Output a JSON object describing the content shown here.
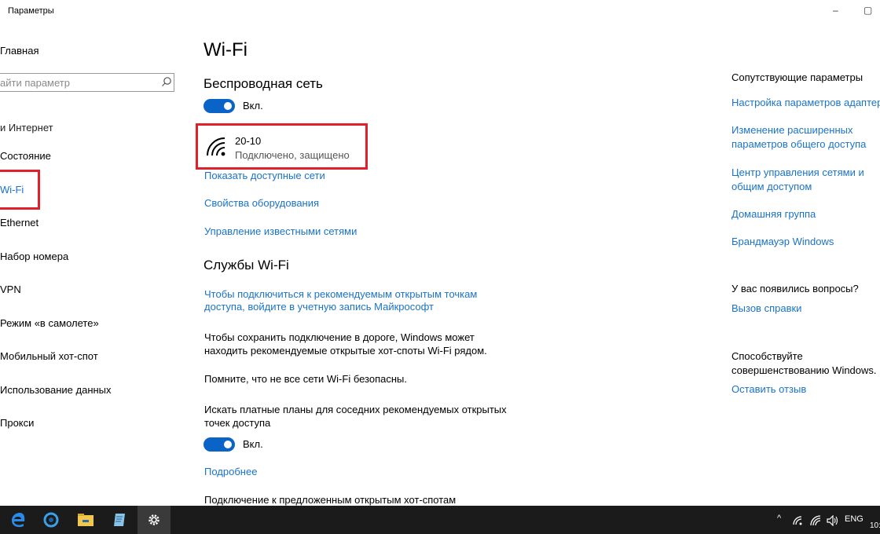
{
  "window": {
    "title": "Параметры",
    "minimize": "–",
    "restore": "▢"
  },
  "sidebar": {
    "home": "Главная",
    "search_placeholder": "айти параметр",
    "section": "и Интернет",
    "items": [
      {
        "label": "Состояние"
      },
      {
        "label": "Wi-Fi"
      },
      {
        "label": "Ethernet"
      },
      {
        "label": "Набор номера"
      },
      {
        "label": "VPN"
      },
      {
        "label": "Режим «в самолете»"
      },
      {
        "label": "Мобильный хот-спот"
      },
      {
        "label": "Использование данных"
      },
      {
        "label": "Прокси"
      }
    ]
  },
  "main": {
    "title": "Wi-Fi",
    "wireless_heading": "Беспроводная сеть",
    "wireless_toggle": "Вкл.",
    "network": {
      "name": "20-10",
      "status": "Подключено, защищено"
    },
    "links": [
      "Показать доступные сети",
      "Свойства оборудования",
      "Управление известными сетями"
    ],
    "services_heading": "Службы Wi-Fi",
    "signin_link_line1": "Чтобы подключиться к рекомендуемым открытым точкам",
    "signin_link_line2": "доступа, войдите в учетную запись Майкрософт",
    "info_line1": "Чтобы сохранить подключение в дороге, Windows может",
    "info_line2": "находить рекомендуемые открытые хот-споты Wi-Fi рядом.",
    "warning": "Помните, что не все сети Wi-Fi безопасны.",
    "paid_line1": "Искать платные планы для соседних рекомендуемых открытых",
    "paid_line2": "точек доступа",
    "paid_toggle": "Вкл.",
    "more_link": "Подробнее",
    "cut_text": "Подключение к предложенным открытым хот-спотам"
  },
  "right": {
    "related_heading": "Сопутствующие параметры",
    "related_links": [
      {
        "line1": "Настройка параметров адаптера",
        "line2": ""
      },
      {
        "line1": "Изменение расширенных",
        "line2": "параметров общего доступа"
      },
      {
        "line1": "Центр управления сетями и",
        "line2": "общим доступом"
      },
      {
        "line1": "Домашняя группа",
        "line2": ""
      },
      {
        "line1": "Брандмауэр Windows",
        "line2": ""
      }
    ],
    "questions_heading": "У вас появились вопросы?",
    "help_link": "Вызов справки",
    "improve_line1": "Способствуйте",
    "improve_line2": "совершенствованию Windows.",
    "feedback_link": "Оставить отзыв"
  },
  "taskbar": {
    "apps": [
      "edge-icon",
      "browser-icon",
      "file-explorer-icon",
      "notepad-icon",
      "settings-icon"
    ],
    "tray_chevron": "^",
    "language": "ENG",
    "clock": "10:"
  },
  "colors": {
    "accent": "#0a64c8",
    "link": "#1a73c8",
    "highlight": "#e0202a",
    "taskbar": "#1b1b1b"
  }
}
